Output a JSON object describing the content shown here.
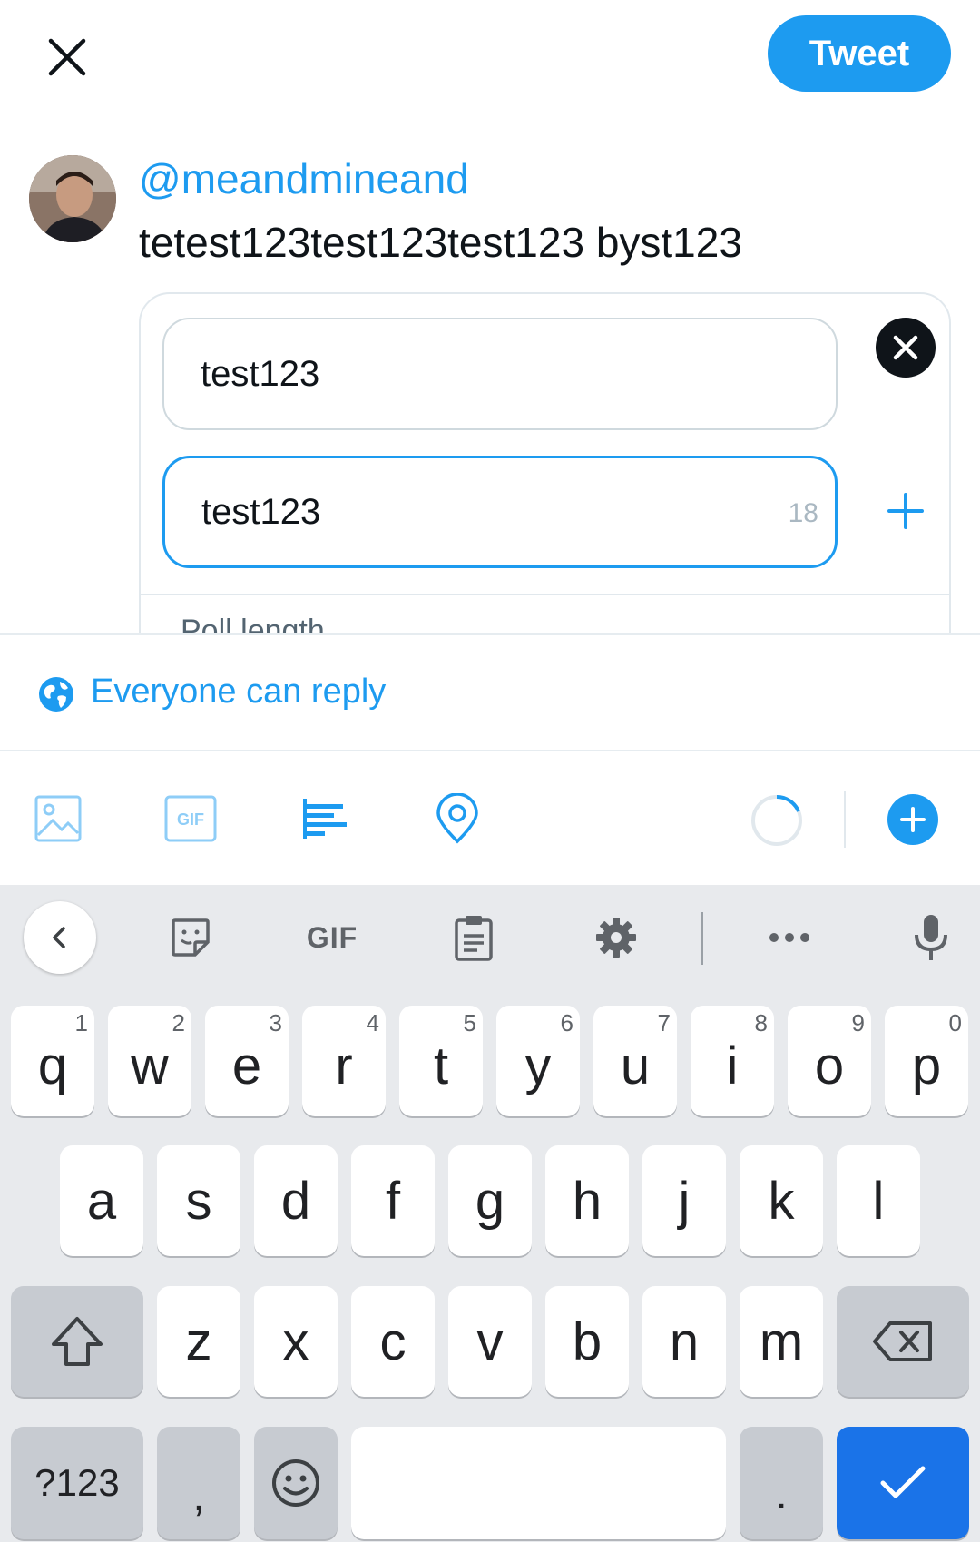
{
  "header": {
    "close_icon": "close-icon",
    "tweet_label": "Tweet"
  },
  "compose": {
    "handle": "@meandmineand",
    "text": "tetest123test123test123 byst123"
  },
  "poll": {
    "choice1_value": "test123",
    "choice2_value": "test123",
    "choice2_char_remaining": "18",
    "poll_length_label": "Poll length"
  },
  "reply_settings": {
    "label": "Everyone can reply",
    "icon": "globe-icon"
  },
  "toolbar": {
    "icons": [
      "image-icon",
      "gif-icon",
      "poll-icon",
      "location-icon"
    ],
    "gif_label": "GIF",
    "accent_color": "#1d9bf0"
  },
  "keyboard": {
    "toolbar_gif": "GIF",
    "row1": [
      {
        "key": "q",
        "hint": "1"
      },
      {
        "key": "w",
        "hint": "2"
      },
      {
        "key": "e",
        "hint": "3"
      },
      {
        "key": "r",
        "hint": "4"
      },
      {
        "key": "t",
        "hint": "5"
      },
      {
        "key": "y",
        "hint": "6"
      },
      {
        "key": "u",
        "hint": "7"
      },
      {
        "key": "i",
        "hint": "8"
      },
      {
        "key": "o",
        "hint": "9"
      },
      {
        "key": "p",
        "hint": "0"
      }
    ],
    "row2": [
      "a",
      "s",
      "d",
      "f",
      "g",
      "h",
      "j",
      "k",
      "l"
    ],
    "row3": [
      "z",
      "x",
      "c",
      "v",
      "b",
      "n",
      "m"
    ],
    "symbols_label": "?123",
    "comma": ",",
    "period": "."
  }
}
